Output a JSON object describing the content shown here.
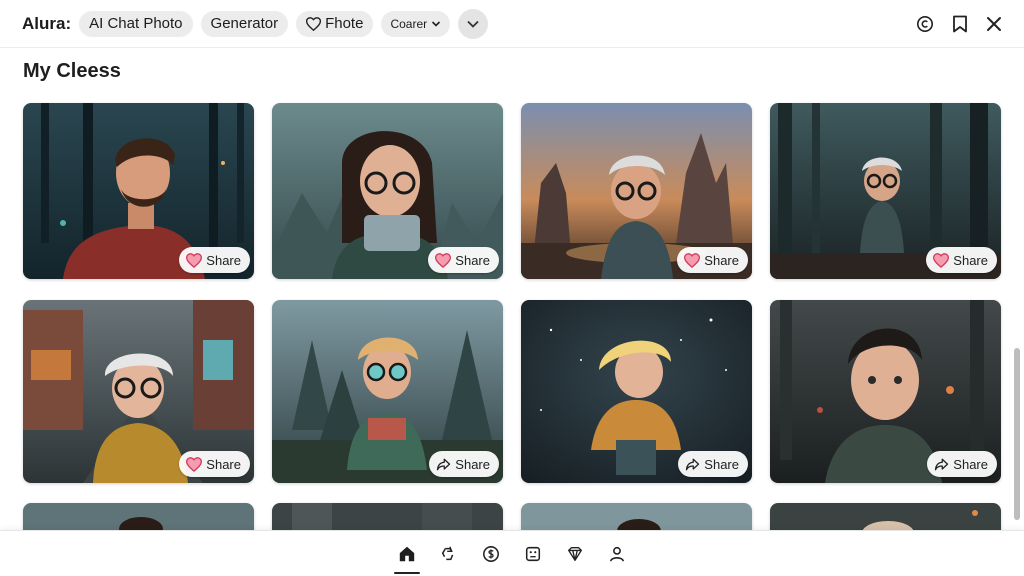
{
  "header": {
    "brand": "Alura:",
    "chips": [
      {
        "label": "AI Chat Photo"
      },
      {
        "label": "Generator"
      },
      {
        "label": "Fhote",
        "icon": "heart-icon"
      },
      {
        "label": "Coarer",
        "icon": "chevron-down-icon"
      }
    ],
    "more_icon": "chevron-down-icon",
    "right_icons": [
      "copyright-icon",
      "bookmark-icon",
      "close-icon"
    ]
  },
  "main": {
    "title": "My Cleess",
    "cards": [
      {
        "subject": "bearded man in red hoodie, night forest",
        "share": "Share",
        "share_icon": "heart-icon"
      },
      {
        "subject": "girl with glasses holding phone",
        "share": "Share",
        "share_icon": "heart-icon"
      },
      {
        "subject": "old man with glasses, canyon sunset",
        "share": "Share",
        "share_icon": "heart-icon"
      },
      {
        "subject": "small old man walking in dark forest",
        "share": "Share",
        "share_icon": "heart-icon"
      },
      {
        "subject": "white-haired kid running in street",
        "share": "Share",
        "share_icon": "heart-icon"
      },
      {
        "subject": "boy with goggles in pine forest",
        "share": "Share",
        "share_icon": "share-arrow-icon"
      },
      {
        "subject": "blonde kid leaping under stars",
        "share": "Share",
        "share_icon": "share-arrow-icon"
      },
      {
        "subject": "dark-haired boy in forest lights",
        "share": "Share",
        "share_icon": "share-arrow-icon"
      },
      {
        "subject": "partial card",
        "share": ""
      },
      {
        "subject": "partial card",
        "share": ""
      },
      {
        "subject": "partial card",
        "share": ""
      },
      {
        "subject": "partial card",
        "share": ""
      }
    ]
  },
  "bottom_nav": {
    "items": [
      "home-icon",
      "recycle-icon",
      "coin-icon",
      "grid-icon",
      "heart-outline-icon",
      "profile-icon"
    ],
    "active": "home-icon"
  }
}
